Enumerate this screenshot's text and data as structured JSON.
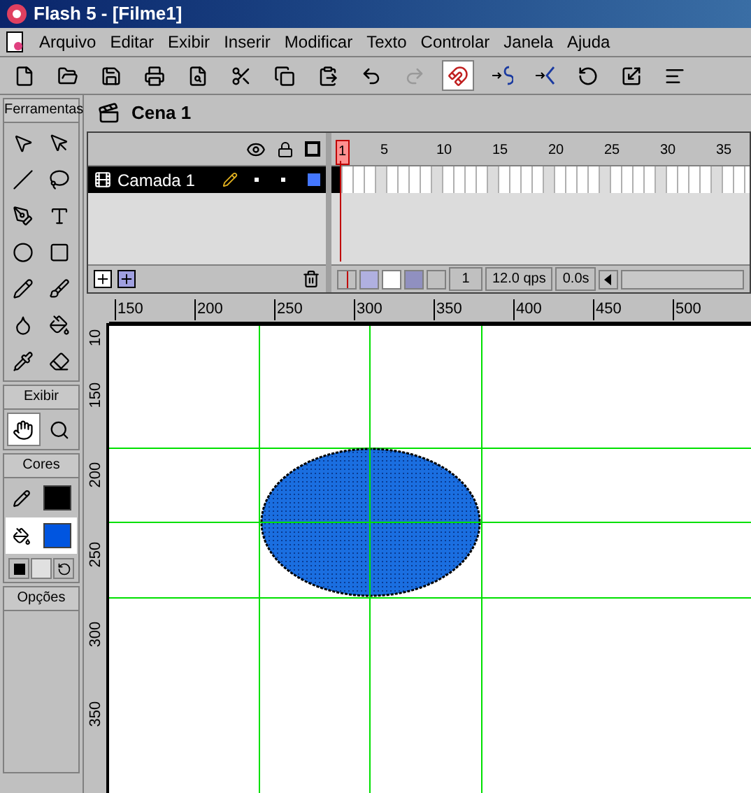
{
  "window": {
    "title": "Flash 5 - [Filme1]"
  },
  "menu": [
    "Arquivo",
    "Editar",
    "Exibir",
    "Inserir",
    "Modificar",
    "Texto",
    "Controlar",
    "Janela",
    "Ajuda"
  ],
  "toolbar": [
    {
      "kind": "new",
      "selected": false
    },
    {
      "kind": "open",
      "selected": false
    },
    {
      "kind": "save",
      "selected": false
    },
    {
      "kind": "print",
      "selected": false
    },
    {
      "kind": "preview",
      "selected": false
    },
    {
      "kind": "cut",
      "selected": false
    },
    {
      "kind": "copy",
      "selected": false
    },
    {
      "kind": "paste",
      "selected": false
    },
    {
      "kind": "undo",
      "selected": false
    },
    {
      "kind": "redo",
      "selected": false
    },
    {
      "kind": "magnet",
      "selected": true
    },
    {
      "kind": "smooth",
      "selected": false
    },
    {
      "kind": "straighten",
      "selected": false
    },
    {
      "kind": "rotate",
      "selected": false
    },
    {
      "kind": "scale",
      "selected": false
    },
    {
      "kind": "align",
      "selected": false
    }
  ],
  "toolbox": {
    "title": "Ferramentas",
    "tools": [
      {
        "kind": "arrow",
        "selected": false
      },
      {
        "kind": "subselect",
        "selected": false
      },
      {
        "kind": "line",
        "selected": false
      },
      {
        "kind": "lasso",
        "selected": false
      },
      {
        "kind": "pen",
        "selected": false
      },
      {
        "kind": "text",
        "selected": false
      },
      {
        "kind": "oval",
        "selected": false
      },
      {
        "kind": "rect",
        "selected": false
      },
      {
        "kind": "pencil",
        "selected": false
      },
      {
        "kind": "brush",
        "selected": false
      },
      {
        "kind": "ink",
        "selected": false
      },
      {
        "kind": "bucket",
        "selected": false
      },
      {
        "kind": "dropper",
        "selected": false
      },
      {
        "kind": "eraser",
        "selected": false
      }
    ]
  },
  "view": {
    "title": "Exibir",
    "tools": [
      {
        "kind": "hand",
        "selected": true
      },
      {
        "kind": "zoom",
        "selected": false
      }
    ]
  },
  "colors": {
    "title": "Cores",
    "stroke": {
      "color": "#000000",
      "selected": false
    },
    "fill": {
      "color": "#0055e0",
      "selected": true
    }
  },
  "options": {
    "title": "Opções"
  },
  "scene": "Cena 1",
  "layers": [
    {
      "name": "Camada 1",
      "selected": true,
      "color": "#4477ff"
    }
  ],
  "frame_numbers": [
    "1",
    "5",
    "10",
    "15",
    "20",
    "25",
    "30",
    "35"
  ],
  "timeline_status": {
    "frame": "1",
    "rate": "12.0 qps",
    "time": "0.0s"
  },
  "ruler_h": [
    "150",
    "200",
    "250",
    "300",
    "350",
    "400",
    "450",
    "500"
  ],
  "ruler_v": [
    "10",
    "150",
    "200",
    "250",
    "300",
    "350"
  ]
}
